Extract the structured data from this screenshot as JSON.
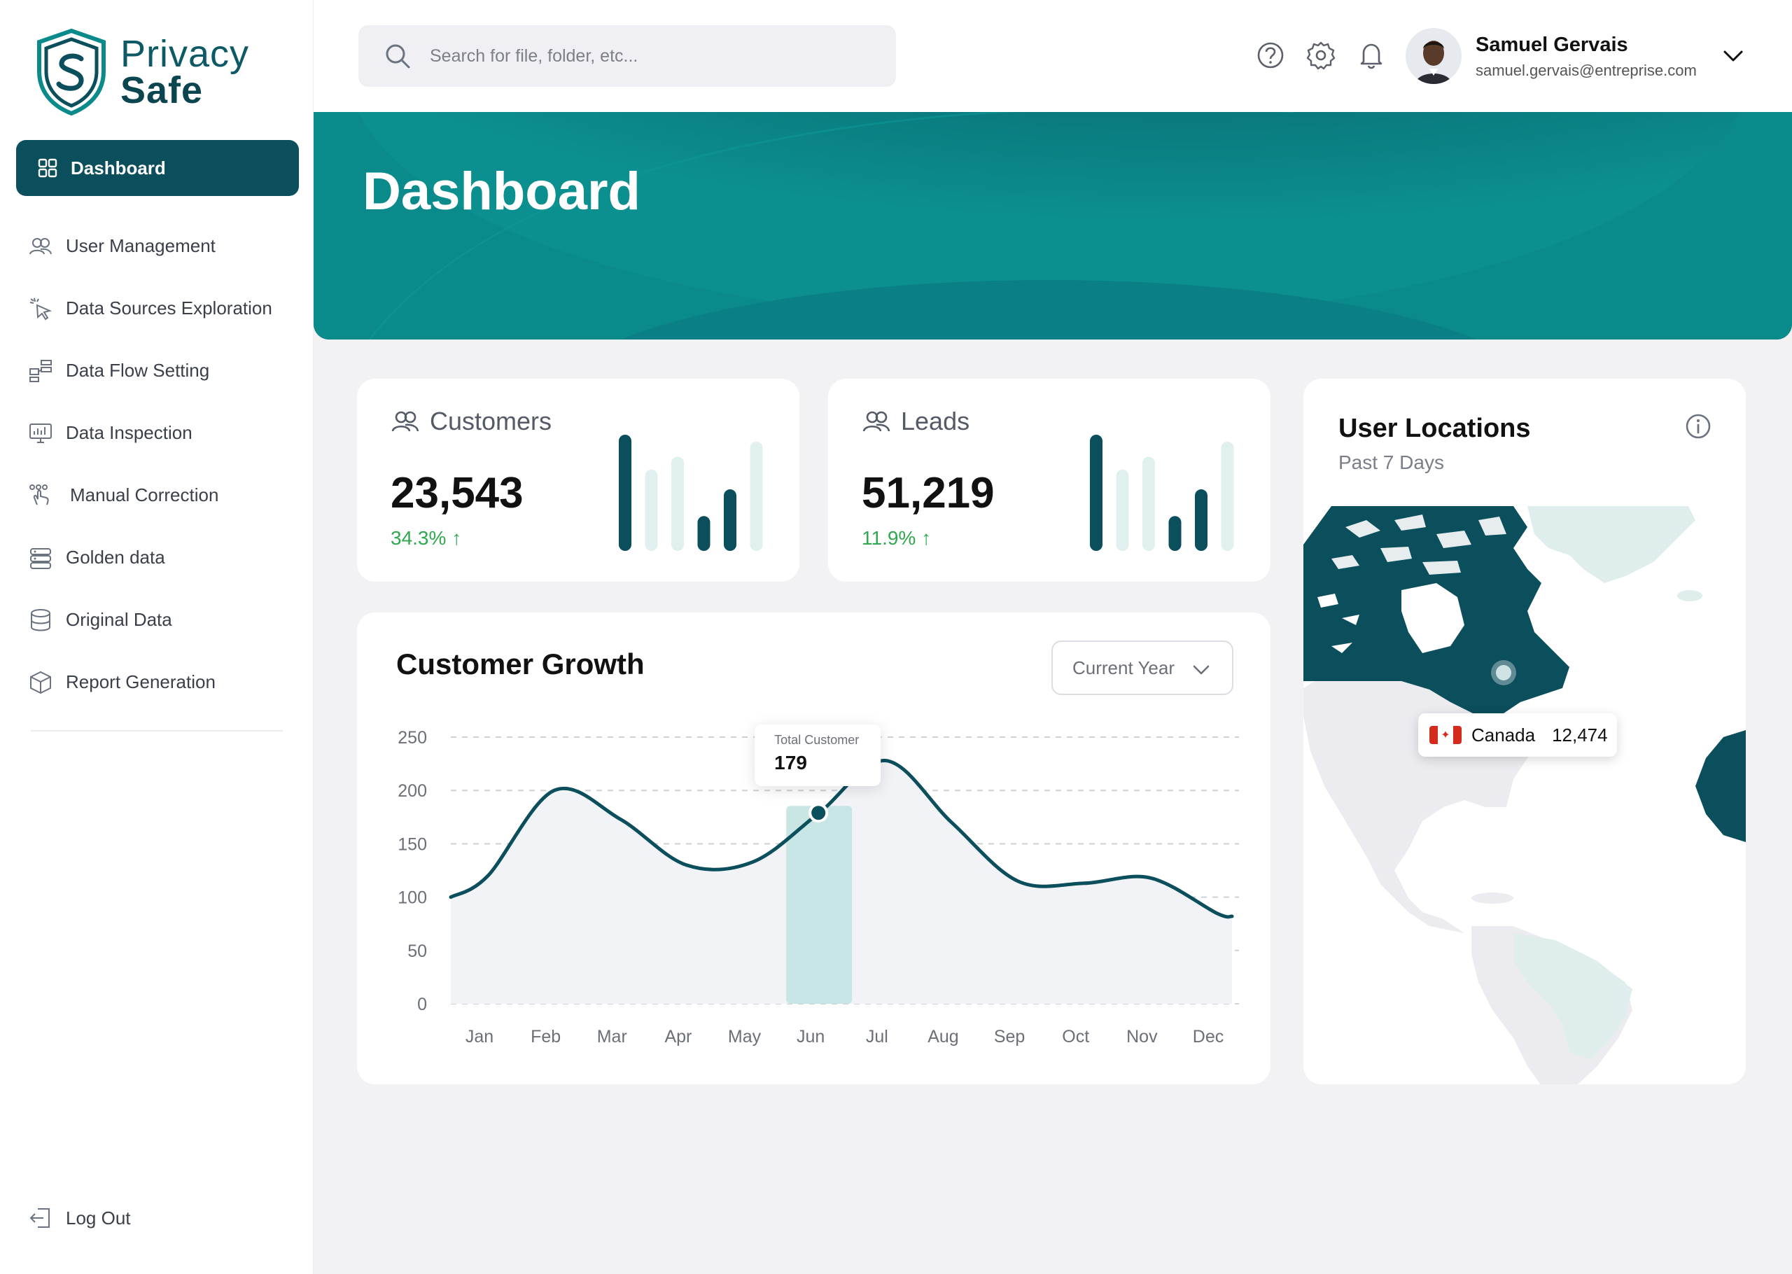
{
  "brand": {
    "line1": "Privacy",
    "line2": "Safe",
    "logo_icon": "shield-s-icon"
  },
  "sidebar": {
    "active": {
      "label": "Dashboard",
      "icon": "grid-icon"
    },
    "items": [
      {
        "label": "User Management",
        "icon": "users-icon"
      },
      {
        "label": "Data Sources Exploration",
        "icon": "cursor-click-icon"
      },
      {
        "label": "Data Flow Setting",
        "icon": "flow-icon"
      },
      {
        "label": "Data Inspection",
        "icon": "monitor-chart-icon"
      },
      {
        "label": "Manual Correction",
        "icon": "hand-pointer-icon"
      },
      {
        "label": "Golden data",
        "icon": "server-icon"
      },
      {
        "label": "Original Data",
        "icon": "database-icon"
      },
      {
        "label": "Report Generation",
        "icon": "box-icon"
      }
    ],
    "logout": "Log Out"
  },
  "header": {
    "search_placeholder": "Search for file, folder, etc...",
    "user": {
      "name": "Samuel Gervais",
      "email": "samuel.gervais@entreprise.com"
    }
  },
  "hero": {
    "title": "Dashboard"
  },
  "stats": {
    "customers": {
      "label": "Customers",
      "value": "23,543",
      "change": "34.3%",
      "bars": [
        100,
        70,
        81,
        30,
        53,
        94
      ]
    },
    "leads": {
      "label": "Leads",
      "value": "51,219",
      "change": "11.9%",
      "bars": [
        100,
        70,
        81,
        30,
        53,
        94
      ]
    }
  },
  "growth": {
    "title": "Customer Growth",
    "filter": "Current Year",
    "tooltip": {
      "label": "Total Customer",
      "value": "179"
    },
    "highlight_month": "Jun"
  },
  "locations": {
    "title": "User Locations",
    "subtitle": "Past 7 Days",
    "tooltip": {
      "country": "Canada",
      "value": "12,474",
      "flag_leaf": "✦"
    },
    "zoom_in": "+",
    "zoom_out": "−"
  },
  "colors": {
    "primary": "#0b4e5c",
    "accent": "#0a8f8f",
    "light_bar": "#dff0ef",
    "positive": "#2fa84f"
  },
  "chart_data": {
    "type": "line",
    "categories": [
      "Jan",
      "Feb",
      "Mar",
      "Apr",
      "May",
      "Jun",
      "Jul",
      "Aug",
      "Sep",
      "Oct",
      "Nov",
      "Dec"
    ],
    "values": [
      120,
      200,
      173,
      130,
      133,
      179,
      228,
      170,
      115,
      113,
      118,
      85
    ],
    "ylim": [
      0,
      250
    ],
    "yticks": [
      0,
      50,
      100,
      150,
      200,
      250
    ],
    "grid": true
  }
}
